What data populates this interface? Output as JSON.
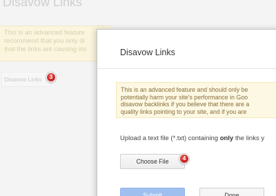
{
  "background": {
    "title": "Disavow Links",
    "warning_lines": [
      "This is an advanced feature",
      "recommend that you only di",
      "that the links are causing iss"
    ],
    "disavow_button_label": "Disavow Links"
  },
  "badges": {
    "step3": "3",
    "step4": "4"
  },
  "dialog": {
    "title": "Disavow Links",
    "warning_lines": [
      "This is an advanced feature and should only be",
      "potentially harm your site's performance in Goo",
      "disavow backlinks if you believe that there are a",
      "quality links pointing to your site, and if you are"
    ],
    "upload_prefix": "Upload a text file (*.txt) containing ",
    "upload_bold": "only",
    "upload_suffix": " the links y",
    "choose_file_label": "Choose File",
    "submit_label": "Submit",
    "done_label": "Done"
  },
  "colors": {
    "warning_bg": "#fcf8e3",
    "badge": "#c41b1b",
    "submit_disabled": "#9fc0ef"
  }
}
